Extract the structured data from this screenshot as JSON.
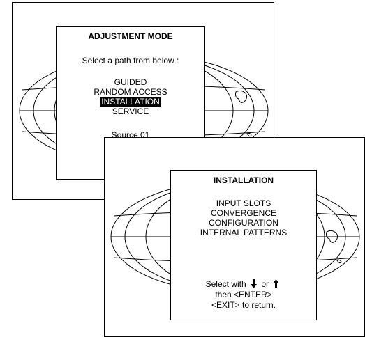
{
  "adjustment_menu": {
    "title": "ADJUSTMENT MODE",
    "prompt": "Select a path from below :",
    "items": [
      "GUIDED",
      "RANDOM ACCESS",
      "INSTALLATION",
      "SERVICE"
    ],
    "selected_index": 2,
    "source": "Source 01"
  },
  "installation_menu": {
    "title": "INSTALLATION",
    "items": [
      "INPUT SLOTS",
      "CONVERGENCE",
      "CONFIGURATION",
      "INTERNAL PATTERNS"
    ],
    "hint_select": "Select with",
    "hint_or": "or",
    "hint_enter": "then <ENTER>",
    "hint_exit": "<EXIT> to return.",
    "icons": {
      "down": "arrow-down-icon",
      "up": "arrow-up-icon"
    }
  },
  "colors": {
    "background": "#ffffff",
    "foreground": "#000000",
    "highlight_bg": "#000000",
    "highlight_fg": "#ffffff"
  }
}
